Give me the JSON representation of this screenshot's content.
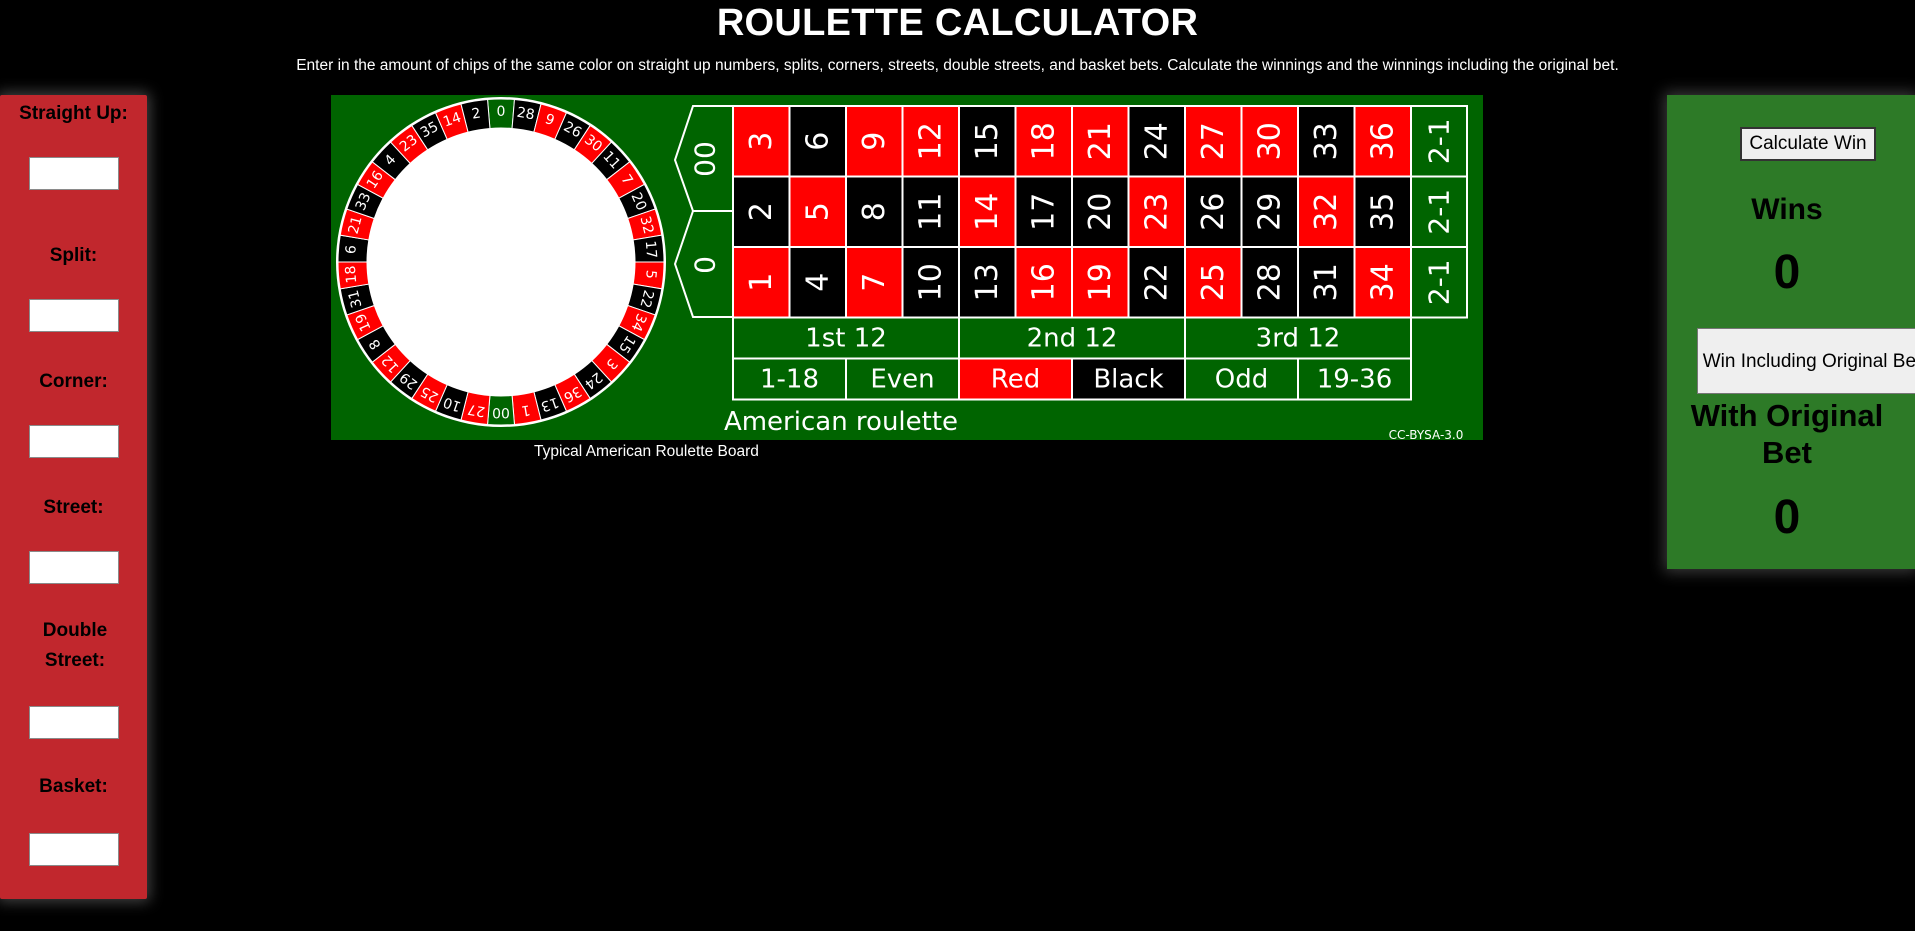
{
  "page": {
    "title": "ROULETTE CALCULATOR",
    "subtitle": "Enter in the amount of chips of the same color on straight up numbers, splits, corners, streets, double streets, and basket bets. Calculate the winnings and the winnings including the original bet."
  },
  "inputs": [
    {
      "id": "straight",
      "label": "Straight Up:",
      "value": ""
    },
    {
      "id": "split",
      "label": "Split:",
      "value": ""
    },
    {
      "id": "corner",
      "label": "Corner:",
      "value": ""
    },
    {
      "id": "street",
      "label": "Street:",
      "value": ""
    },
    {
      "id": "double",
      "label": "Double Street:",
      "value": ""
    },
    {
      "id": "basket",
      "label": "Basket:",
      "value": ""
    }
  ],
  "board": {
    "caption": "Typical American Roulette Board",
    "name": "American roulette",
    "license": "CC-BYSA-3.0",
    "zeros": [
      "00",
      "0"
    ],
    "rows": [
      [
        "3",
        "6",
        "9",
        "12",
        "15",
        "18",
        "21",
        "24",
        "27",
        "30",
        "33",
        "36"
      ],
      [
        "2",
        "5",
        "8",
        "11",
        "14",
        "17",
        "20",
        "23",
        "26",
        "29",
        "32",
        "35"
      ],
      [
        "1",
        "4",
        "7",
        "10",
        "13",
        "16",
        "19",
        "22",
        "25",
        "28",
        "31",
        "34"
      ]
    ],
    "red_numbers": [
      "1",
      "3",
      "5",
      "7",
      "9",
      "12",
      "14",
      "16",
      "18",
      "19",
      "21",
      "23",
      "25",
      "27",
      "30",
      "32",
      "34",
      "36"
    ],
    "column_bets": [
      "2-1",
      "2-1",
      "2-1"
    ],
    "dozens": [
      "1st 12",
      "2nd 12",
      "3rd 12"
    ],
    "outside_bets": [
      "1-18",
      "Even",
      "Red",
      "Black",
      "Odd",
      "19-36"
    ],
    "wheel_order": [
      "0",
      "28",
      "9",
      "26",
      "30",
      "11",
      "7",
      "20",
      "32",
      "17",
      "5",
      "22",
      "34",
      "15",
      "3",
      "24",
      "36",
      "13",
      "1",
      "00",
      "27",
      "10",
      "25",
      "29",
      "12",
      "8",
      "19",
      "31",
      "18",
      "6",
      "21",
      "33",
      "16",
      "4",
      "23",
      "35",
      "14",
      "2"
    ],
    "colors": {
      "felt": "#006400",
      "red": "#ff0000",
      "black": "#000000",
      "green": "#006400"
    }
  },
  "results": {
    "calculate_button": "Calculate Win",
    "wins_label": "Wins",
    "wins_value": "0",
    "original_button": "Win Including Original Bet",
    "original_label": "With Original Bet",
    "original_value": "0"
  },
  "colors": {
    "left_panel": "#c1272d",
    "right_panel": "#2d7a27",
    "background": "#000000"
  }
}
